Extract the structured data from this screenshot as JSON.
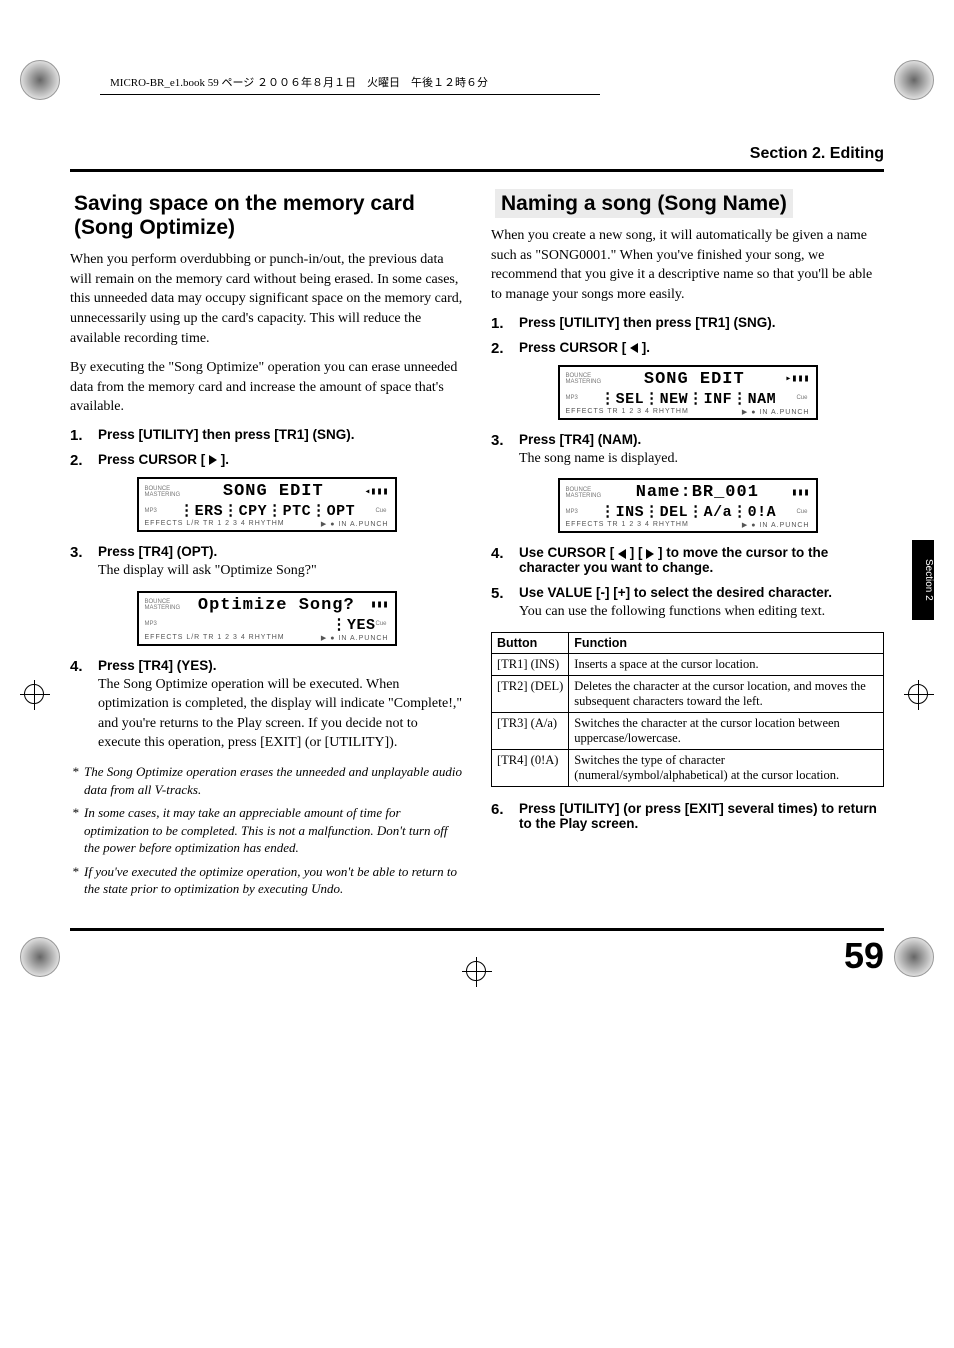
{
  "book_header": "MICRO-BR_e1.book 59 ページ ２００６年８月１日　火曜日　午後１２時６分",
  "section_header": "Section 2. Editing",
  "side_tab": "Section 2",
  "page_number": "59",
  "left": {
    "title": "Saving space on the memory card (Song Optimize)",
    "intro1": "When you perform overdubbing or punch-in/out, the previous data will remain on the memory card without being erased. In some cases, this unneeded data may occupy significant space on the memory card, unnecessarily using up the card's capacity. This will reduce the available recording time.",
    "intro2": "By executing the \"Song Optimize\" operation you can erase unneeded data from the memory card and increase the amount of space that's available.",
    "steps": {
      "s1": "Press [UTILITY] then press [TR1] (SNG).",
      "s2": "Press CURSOR [ ▶ ].",
      "s3": "Press [TR4] (OPT).",
      "s3_sub": "The display will ask \"Optimize Song?\"",
      "s4": "Press [TR4] (YES).",
      "s4_sub": "The Song Optimize operation will be executed. When optimization is completed, the display will indicate \"Complete!,\" and you're returns to the Play screen. If you decide not to execute this operation, press [EXIT] (or [UTILITY])."
    },
    "lcd1": {
      "line1": "SONG EDIT",
      "line2": "⋮ERS⋮CPY⋮PTC⋮OPT",
      "bottom": "EFFECTS L/R TR 1 2 3 4   RHYTHM"
    },
    "lcd2": {
      "line1": "Optimize Song?",
      "line2": "⋮YES",
      "bottom": "EFFECTS L/R TR 1 2 3 4   RHYTHM"
    },
    "notes": [
      "The Song Optimize operation erases the unneeded and unplayable audio data from all V-tracks.",
      "In some cases, it may take an appreciable amount of time for optimization to be completed. This is not a malfunction. Don't turn off the power before optimization has ended.",
      "If you've executed the optimize operation, you won't be able to return to the state prior to optimization by executing Undo."
    ]
  },
  "right": {
    "title": "Naming a song (Song Name)",
    "intro": "When you create a new song, it will automatically be given a name such as \"SONG0001.\" When you've finished your song, we recommend that you give it a descriptive name so that you'll be able to manage your songs more easily.",
    "steps": {
      "s1": "Press [UTILITY] then press [TR1] (SNG).",
      "s2": "Press CURSOR [ ◀ ].",
      "s3": "Press [TR4] (NAM).",
      "s3_sub": "The song name is displayed.",
      "s4": "Use CURSOR [ ◀ ] [ ▶ ] to move the cursor to the character you want to change.",
      "s5": "Use VALUE [-] [+] to select the desired character.",
      "s5_sub": "You can use the following functions when editing text.",
      "s6": "Press [UTILITY] (or press [EXIT] several times) to return to the Play screen."
    },
    "lcd1": {
      "line1": "SONG EDIT",
      "line2": "⋮SEL⋮NEW⋮INF⋮NAM",
      "bottom": "EFFECTS    TR 1 2 3 4   RHYTHM"
    },
    "lcd2": {
      "line1": "Name:BR_001",
      "line2": "⋮INS⋮DEL⋮A/a⋮0!A",
      "bottom": "EFFECTS    TR 1 2 3 4   RHYTHM"
    },
    "table": {
      "head_button": "Button",
      "head_function": "Function",
      "rows": [
        {
          "b": "[TR1] (INS)",
          "f": "Inserts a space at the cursor location."
        },
        {
          "b": "[TR2] (DEL)",
          "f": "Deletes the character at the cursor location, and moves the subsequent characters toward the left."
        },
        {
          "b": "[TR3] (A/a)",
          "f": "Switches the character at the cursor location between uppercase/lowercase."
        },
        {
          "b": "[TR4] (0!A)",
          "f": "Switches the type of character (numeral/symbol/alphabetical) at the cursor location."
        }
      ]
    }
  }
}
